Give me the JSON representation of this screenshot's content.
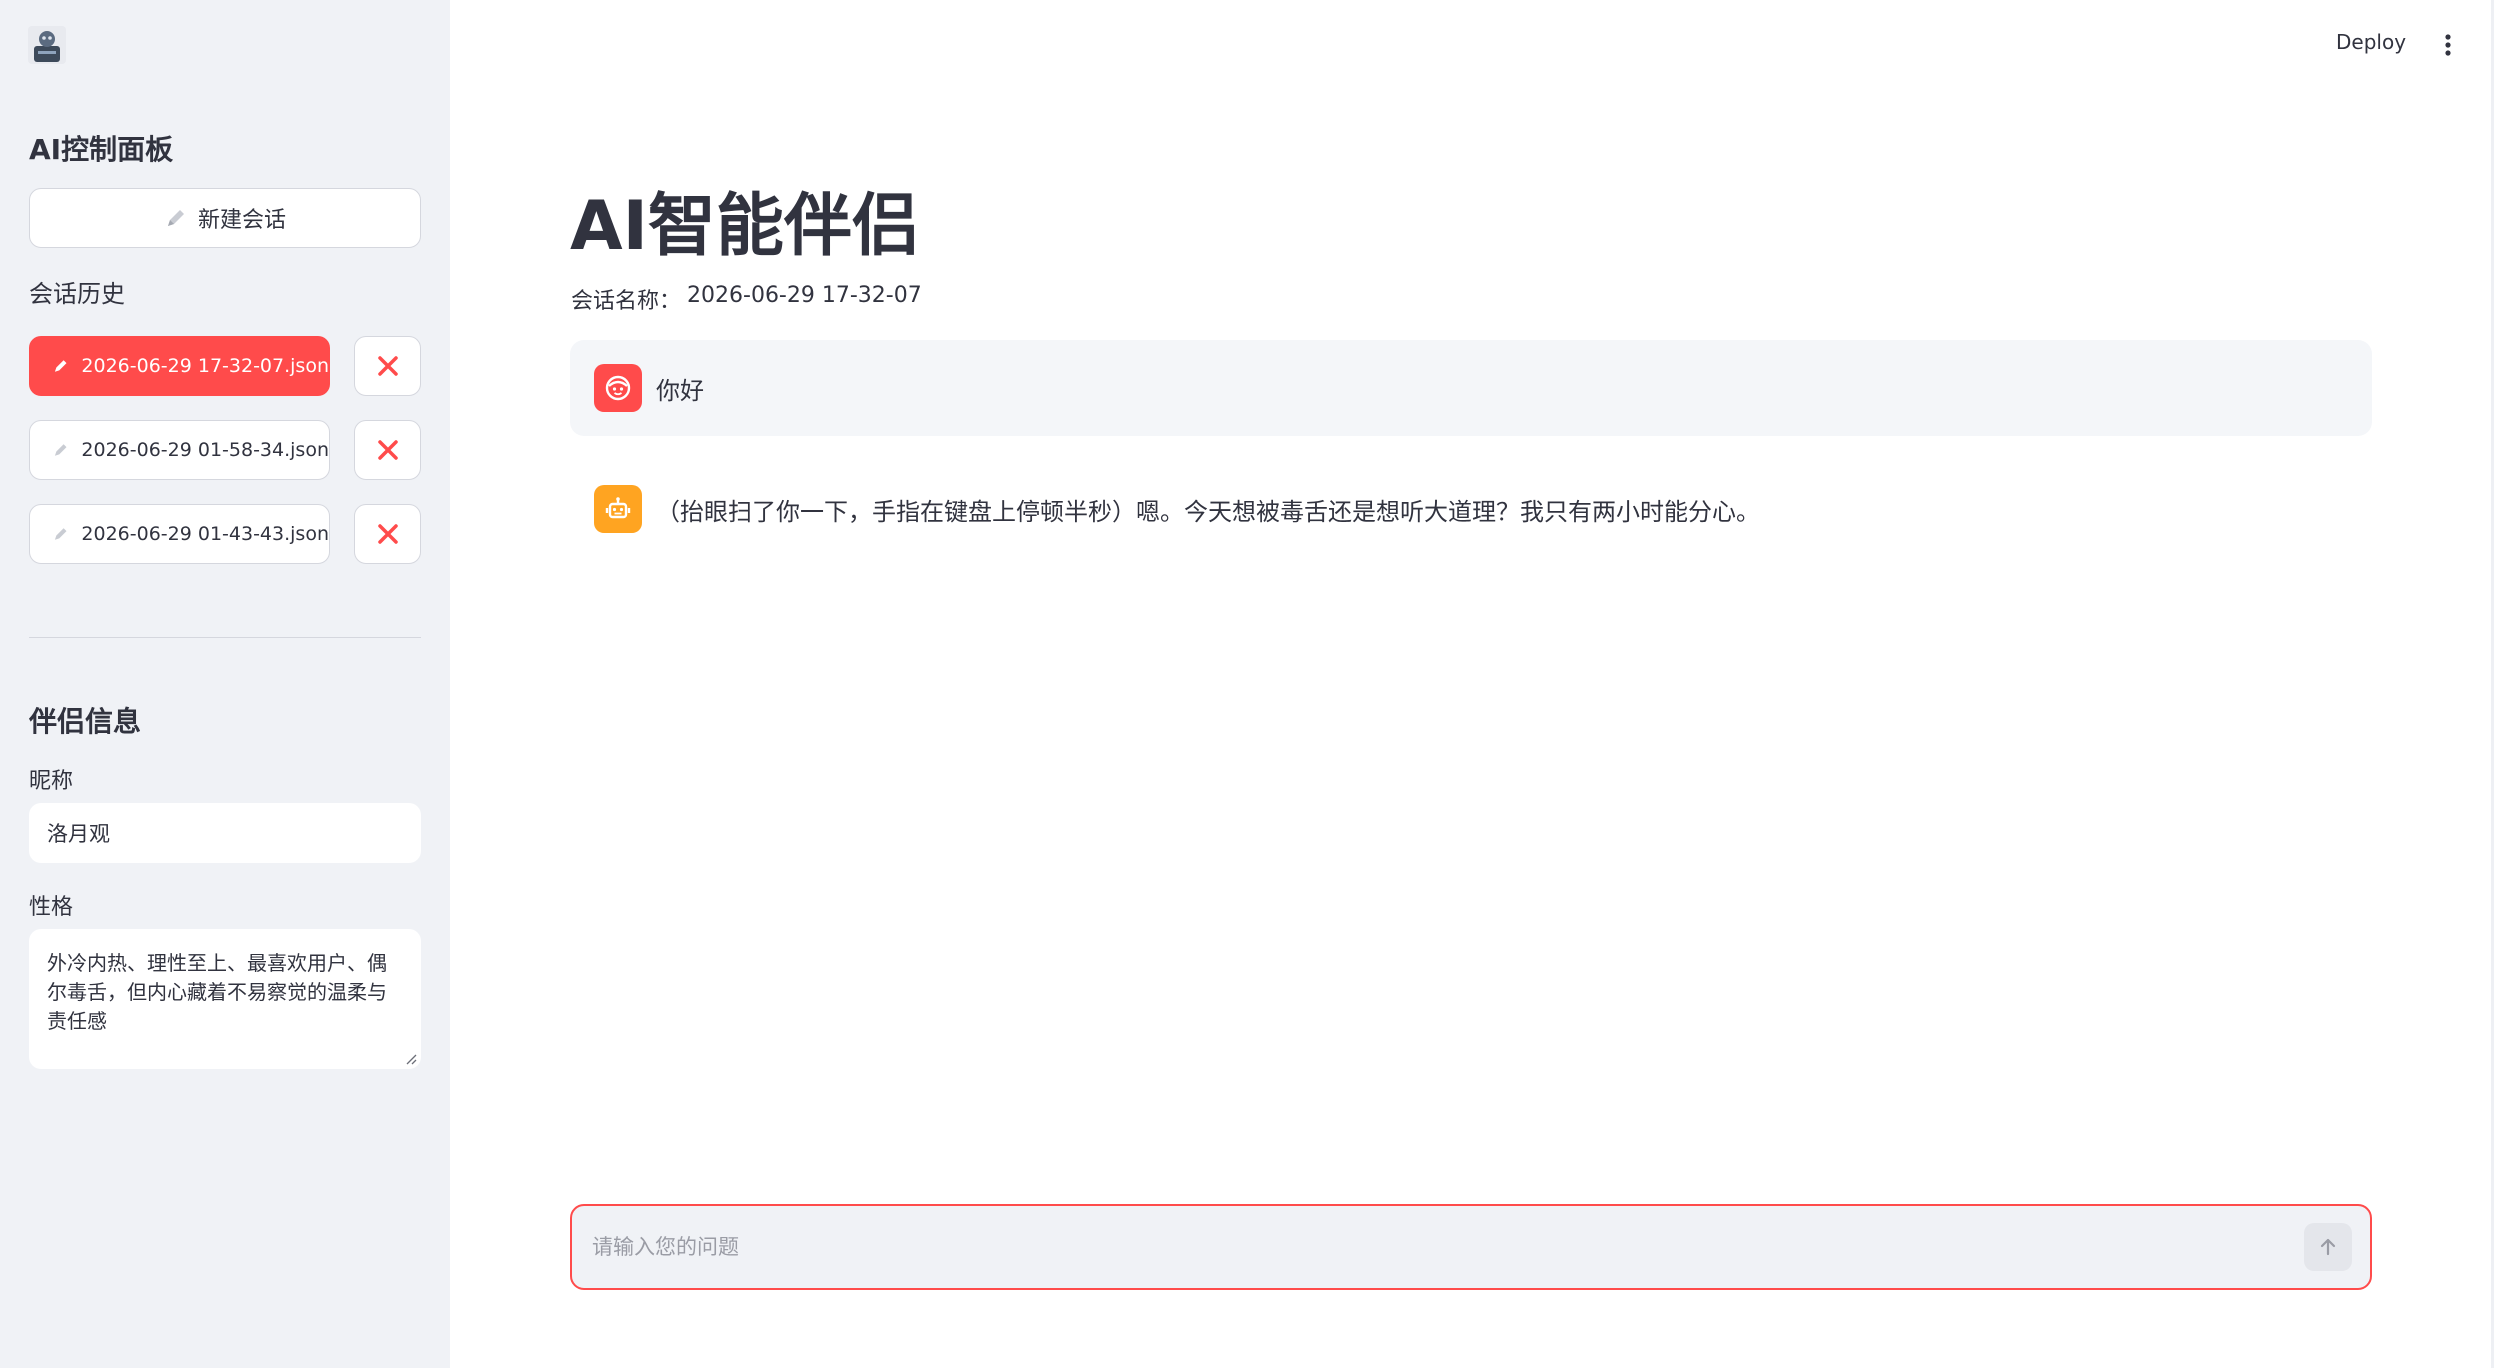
{
  "sidebar": {
    "logo_icon": "robot-avatar-logo-icon",
    "panel_title": "AI控制面板",
    "new_chat_label": "新建会话",
    "history_title": "会话历史",
    "history": [
      {
        "label": "2026-06-29 17-32-07.json",
        "active": true
      },
      {
        "label": "2026-06-29 01-58-34.json",
        "active": false
      },
      {
        "label": "2026-06-29 01-43-43.json",
        "active": false
      }
    ],
    "delete_icon": "close-x-icon",
    "companion_title": "伴侣信息",
    "nickname_label": "昵称",
    "nickname_value": "洛月观",
    "personality_label": "性格",
    "personality_value": "外冷内热、理性至上、最喜欢用户、偶尔毒舌，但内心藏着不易察觉的温柔与责任感"
  },
  "header": {
    "deploy_label": "Deploy",
    "menu_icon": "vertical-dots-menu-icon"
  },
  "main": {
    "title": "AI智能伴侣",
    "session_prefix": "会话名称：",
    "session_name": "2026-06-29 17-32-07",
    "messages": [
      {
        "role": "user",
        "avatar_icon": "user-face-icon",
        "text": "你好"
      },
      {
        "role": "assistant",
        "avatar_icon": "robot-icon",
        "text": "（抬眼扫了你一下，手指在键盘上停顿半秒）嗯。今天想被毒舌还是想听大道理？我只有两小时能分心。"
      }
    ],
    "input_placeholder": "请输入您的问题",
    "send_icon": "arrow-up-icon"
  },
  "colors": {
    "accent": "#ff4b4b",
    "assistant_avatar": "#ffa421",
    "sidebar_bg": "#f0f2f6",
    "user_message_bg": "#f4f6f9"
  }
}
